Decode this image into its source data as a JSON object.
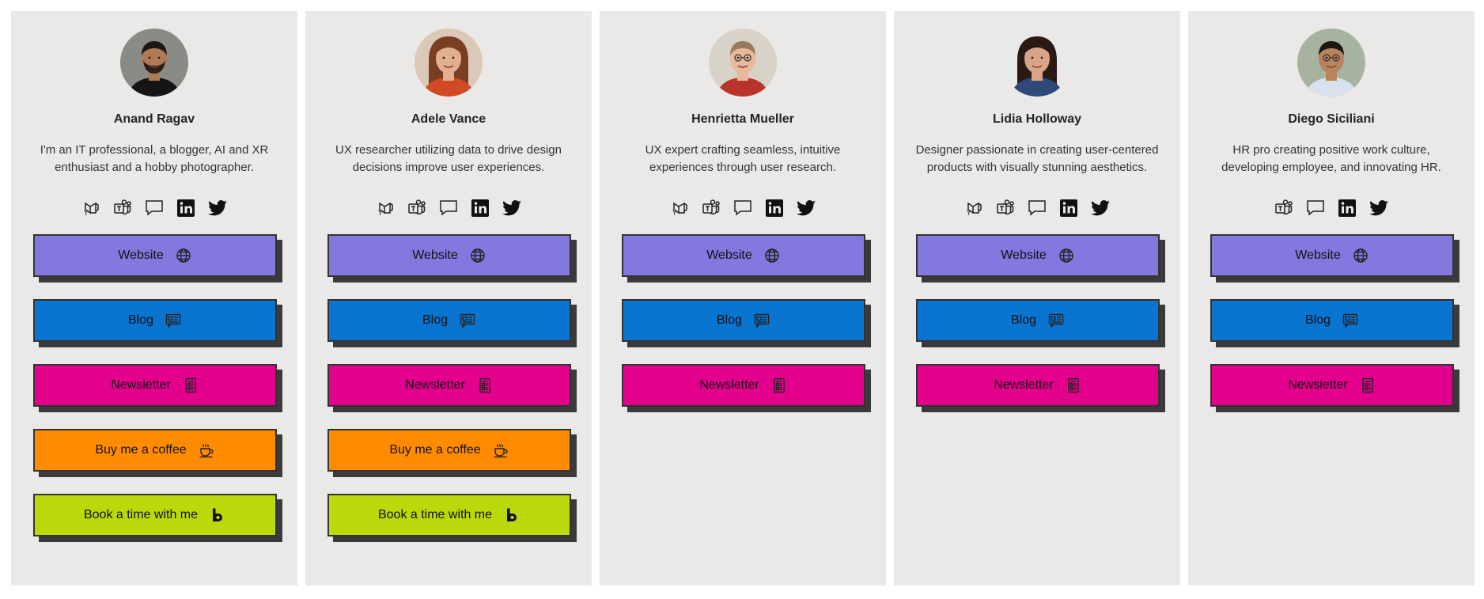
{
  "profiles": [
    {
      "name": "Anand Ragav",
      "bio": "I'm an IT professional, a blogger, AI and XR enthusiast and a hobby photographer.",
      "socials": [
        "viva-engage-icon",
        "teams-icon",
        "chat-icon",
        "linkedin-icon",
        "twitter-icon"
      ],
      "buttons": [
        {
          "label": "Website",
          "icon": "globe-icon"
        },
        {
          "label": "Blog",
          "icon": "news-icon"
        },
        {
          "label": "Newsletter",
          "icon": "document-icon"
        },
        {
          "label": "Buy me a coffee",
          "icon": "coffee-icon"
        },
        {
          "label": "Book a time with me",
          "icon": "bookings-icon"
        }
      ]
    },
    {
      "name": "Adele Vance",
      "bio": "UX researcher utilizing data to drive design decisions improve user experiences.",
      "socials": [
        "viva-engage-icon",
        "teams-icon",
        "chat-icon",
        "linkedin-icon",
        "twitter-icon"
      ],
      "buttons": [
        {
          "label": "Website",
          "icon": "globe-icon"
        },
        {
          "label": "Blog",
          "icon": "news-icon"
        },
        {
          "label": "Newsletter",
          "icon": "document-icon"
        },
        {
          "label": "Buy me a coffee",
          "icon": "coffee-icon"
        },
        {
          "label": "Book a time with me",
          "icon": "bookings-icon"
        }
      ]
    },
    {
      "name": "Henrietta Mueller",
      "bio": "UX expert crafting seamless, intuitive experiences through user research.",
      "socials": [
        "viva-engage-icon",
        "teams-icon",
        "chat-icon",
        "linkedin-icon",
        "twitter-icon"
      ],
      "buttons": [
        {
          "label": "Website",
          "icon": "globe-icon"
        },
        {
          "label": "Blog",
          "icon": "news-icon"
        },
        {
          "label": "Newsletter",
          "icon": "document-icon"
        }
      ]
    },
    {
      "name": "Lidia Holloway",
      "bio": "Designer passionate in creating user-centered products with visually stunning aesthetics.",
      "socials": [
        "viva-engage-icon",
        "teams-icon",
        "chat-icon",
        "linkedin-icon",
        "twitter-icon"
      ],
      "buttons": [
        {
          "label": "Website",
          "icon": "globe-icon"
        },
        {
          "label": "Blog",
          "icon": "news-icon"
        },
        {
          "label": "Newsletter",
          "icon": "document-icon"
        }
      ]
    },
    {
      "name": "Diego Siciliani",
      "bio": "HR pro creating positive work culture, developing employee, and innovating HR.",
      "socials": [
        "teams-icon",
        "chat-icon",
        "linkedin-icon",
        "twitter-icon"
      ],
      "buttons": [
        {
          "label": "Website",
          "icon": "globe-icon"
        },
        {
          "label": "Blog",
          "icon": "news-icon"
        },
        {
          "label": "Newsletter",
          "icon": "document-icon"
        }
      ]
    }
  ],
  "colors": {
    "website": "#8378de",
    "blog": "#0a74d1",
    "newsletter": "#e3008c",
    "coffee": "#ff8c00",
    "booking": "#bad80a",
    "card_bg": "#ebe9e7"
  }
}
